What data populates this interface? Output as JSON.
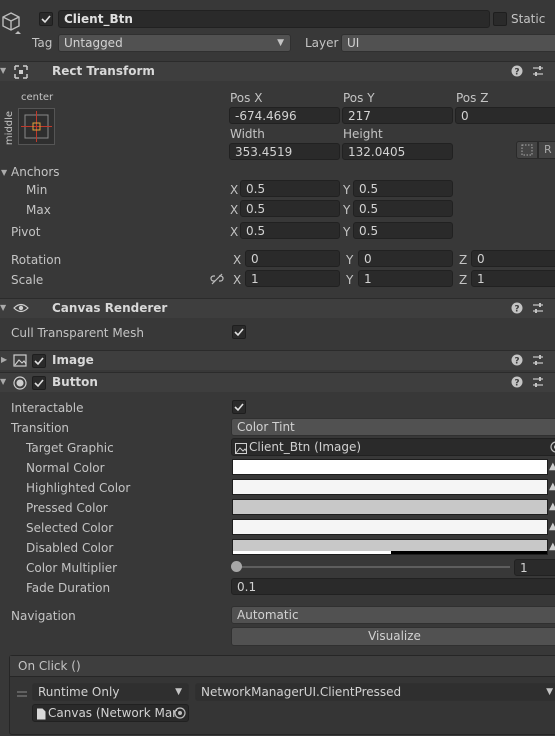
{
  "object": {
    "name": "Client_Btn",
    "static_label": "Static",
    "tag_label": "Tag",
    "tag_value": "Untagged",
    "layer_label": "Layer",
    "layer_value": "UI"
  },
  "rect_transform": {
    "title": "Rect Transform",
    "anchor_preset_h": "center",
    "anchor_preset_v": "middle",
    "pos_x_label": "Pos X",
    "pos_x": "-674.4696",
    "pos_y_label": "Pos Y",
    "pos_y": "217",
    "pos_z_label": "Pos Z",
    "pos_z": "0",
    "width_label": "Width",
    "width": "353.4519",
    "height_label": "Height",
    "height": "132.0405",
    "r_button": "R",
    "anchors_label": "Anchors",
    "min_label": "Min",
    "min_x": "0.5",
    "min_y": "0.5",
    "max_label": "Max",
    "max_x": "0.5",
    "max_y": "0.5",
    "pivot_label": "Pivot",
    "pivot_x": "0.5",
    "pivot_y": "0.5",
    "rotation_label": "Rotation",
    "rot_x": "0",
    "rot_y": "0",
    "rot_z": "0",
    "scale_label": "Scale",
    "scale_x": "1",
    "scale_y": "1",
    "scale_z": "1",
    "axis_x": "X",
    "axis_y": "Y",
    "axis_z": "Z"
  },
  "canvas_renderer": {
    "title": "Canvas Renderer",
    "cull_label": "Cull Transparent Mesh",
    "cull_checked": true
  },
  "image_component": {
    "title": "Image"
  },
  "button_component": {
    "title": "Button",
    "interactable_label": "Interactable",
    "transition_label": "Transition",
    "transition_value": "Color Tint",
    "target_graphic_label": "Target Graphic",
    "target_graphic_value": "Client_Btn (Image)",
    "normal_color_label": "Normal Color",
    "highlighted_color_label": "Highlighted Color",
    "pressed_color_label": "Pressed Color",
    "selected_color_label": "Selected Color",
    "disabled_color_label": "Disabled Color",
    "color_multiplier_label": "Color Multiplier",
    "color_multiplier_value": "1",
    "fade_duration_label": "Fade Duration",
    "fade_duration_value": "0.1",
    "navigation_label": "Navigation",
    "navigation_value": "Automatic",
    "visualize_label": "Visualize",
    "colors": {
      "normal": "#ffffff",
      "highlighted": "#f5f5f5",
      "pressed": "#c8c8c8",
      "selected": "#f5f5f5",
      "disabled": "#c8c8c8"
    }
  },
  "on_click": {
    "title": "On Click ()",
    "runtime_value": "Runtime Only",
    "function_value": "NetworkManagerUI.ClientPressed",
    "object_value": "Canvas (Network Mar"
  },
  "theme": {
    "background": "#383838",
    "header": "#3e3e3e",
    "field": "#2a2a2a",
    "accent": "#3a79bb"
  }
}
